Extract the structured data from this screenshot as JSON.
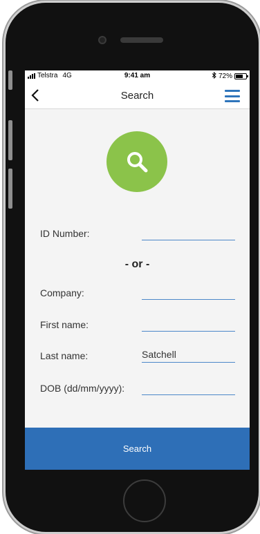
{
  "status_bar": {
    "carrier": "Telstra",
    "network": "4G",
    "time": "9:41 am",
    "bluetooth_icon": "bluetooth-icon",
    "battery_percent": "72%",
    "battery_level": 0.72
  },
  "nav": {
    "title": "Search",
    "back_icon": "chevron-left-icon",
    "menu_icon": "hamburger-menu-icon"
  },
  "hero_icon": "magnifier-icon",
  "form": {
    "id_number": {
      "label": "ID Number:",
      "value": ""
    },
    "or_text": "- or -",
    "company": {
      "label": "Company:",
      "value": ""
    },
    "first_name": {
      "label": "First name:",
      "value": ""
    },
    "last_name": {
      "label": "Last name:",
      "value": "Satchell"
    },
    "dob": {
      "label": "DOB (dd/mm/yyyy):",
      "value": ""
    }
  },
  "submit_label": "Search",
  "colors": {
    "accent_blue": "#2e6fb7",
    "badge_green": "#8bc34a",
    "input_underline": "#4a86c8",
    "screen_bg": "#f4f4f4"
  }
}
